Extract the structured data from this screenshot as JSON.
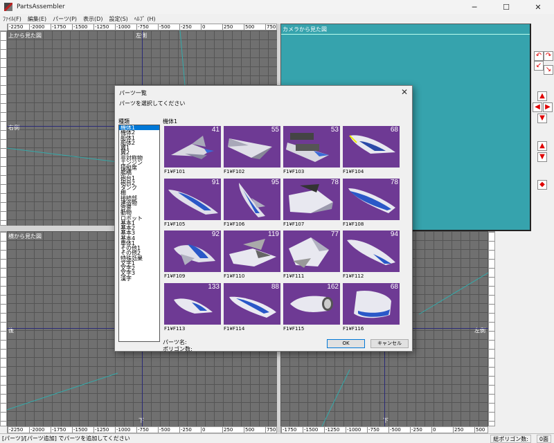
{
  "window": {
    "title": "PartsAssembler",
    "minimize": "─",
    "maximize": "☐",
    "close": "✕"
  },
  "menu": [
    {
      "label": "ﾌｧｲﾙ(F)"
    },
    {
      "label": "編集(E)"
    },
    {
      "label": "パーツ(P)"
    },
    {
      "label": "表示(D)"
    },
    {
      "label": "設定(S)"
    },
    {
      "label": "ﾍﾙﾌﾟ (H)"
    }
  ],
  "views": {
    "top": {
      "label": "上から見た図",
      "side_left": "左側",
      "side_right": "右側"
    },
    "camera": {
      "label": "カメラから見た図"
    },
    "side": {
      "label": "横から見た図",
      "side_left": "後",
      "side_right": "左側",
      "bottom": "下"
    },
    "bottom_right": {
      "bottom": "下"
    }
  },
  "ruler": {
    "ticks_top_left": [
      "-2250",
      "-2000",
      "-1750",
      "-1500",
      "-1250",
      "-1000",
      "-750",
      "-500",
      "-250",
      "0",
      "250",
      "500",
      "750",
      "1000",
      "1250",
      "1500",
      "1750",
      "2000",
      "2250"
    ],
    "ticks_bottom_left": [
      "-2250",
      "-2000",
      "-1750",
      "-1500",
      "-1250",
      "-1000",
      "-750",
      "-500",
      "-250",
      "0",
      "250",
      "500",
      "750",
      "1000",
      "1250",
      "1500",
      "1750",
      "2000",
      "2250"
    ],
    "ticks_bottom_right": [
      "-1750",
      "-1500",
      "-1250",
      "-1000",
      "-750",
      "-500",
      "-250",
      "0",
      "250",
      "500",
      "750",
      "1000",
      "1250",
      "1500",
      "1750"
    ]
  },
  "tools": [
    {
      "icon": "rotate-left-icon",
      "glyph": "↶"
    },
    {
      "icon": "rotate-right-icon",
      "glyph": "↷"
    },
    {
      "icon": "rotate-down-left-icon",
      "glyph": "↙"
    },
    {
      "icon": "rotate-down-right-icon",
      "glyph": "↘"
    },
    {
      "icon": "move-up-icon",
      "glyph": "▲"
    },
    {
      "icon": "move-left-icon",
      "glyph": "◀"
    },
    {
      "icon": "move-right-icon",
      "glyph": "▶"
    },
    {
      "icon": "move-down-icon",
      "glyph": "▼"
    },
    {
      "icon": "zoom-in-icon",
      "glyph": "▲"
    },
    {
      "icon": "zoom-out-icon",
      "glyph": "▼"
    },
    {
      "icon": "reset-view-icon",
      "glyph": "◆"
    }
  ],
  "status": {
    "left": "[パーツ]/[パーツ追加] でパーツを追加してください",
    "polygons_label": "総ポリゴン数:",
    "polygons_value": "0面"
  },
  "dialog": {
    "title": "パーツ一覧",
    "instruction": "パーツを選択してください",
    "kinds_label": "種類",
    "selected_category": "機体1",
    "kinds": [
      "機体1",
      "機体2",
      "船体1",
      "船体2",
      "翼1",
      "翼2",
      "非対称物",
      "エンジン",
      "操縦席",
      "艦橋",
      "砲台1",
      "砲台2",
      "タンク",
      "棚",
      "接続部",
      "建造物",
      "背景",
      "動物",
      "ロボット",
      "基本1",
      "基本2",
      "基本3",
      "基本4",
      "車体1",
      "その他1",
      "その他2",
      "特殊効果",
      "文字1",
      "文字2",
      "文字3",
      "漢字"
    ],
    "parts": [
      {
        "name": "F1¥F101",
        "count": "41"
      },
      {
        "name": "F1¥F102",
        "count": "55"
      },
      {
        "name": "F1¥F103",
        "count": "53"
      },
      {
        "name": "F1¥F104",
        "count": "68"
      },
      {
        "name": "F1¥F105",
        "count": "91"
      },
      {
        "name": "F1¥F106",
        "count": "95"
      },
      {
        "name": "F1¥F107",
        "count": "78"
      },
      {
        "name": "F1¥F108",
        "count": "78"
      },
      {
        "name": "F1¥F109",
        "count": "92"
      },
      {
        "name": "F1¥F110",
        "count": "119"
      },
      {
        "name": "F1¥F111",
        "count": "77"
      },
      {
        "name": "F1¥F112",
        "count": "94"
      },
      {
        "name": "F1¥F113",
        "count": "133"
      },
      {
        "name": "F1¥F114",
        "count": "88"
      },
      {
        "name": "F1¥F115",
        "count": "162"
      },
      {
        "name": "F1¥F116",
        "count": "68"
      }
    ],
    "part_name_label": "パーツ名:",
    "polygon_count_label": "ポリゴン数:",
    "ok_label": "OK",
    "cancel_label": "キャンセル",
    "close_glyph": "✕"
  },
  "colors": {
    "thumb_bg": "#6e3a94",
    "camera_bg": "#36a3ad",
    "selection": "#0078d7",
    "tool_arrow": "#e00000"
  }
}
